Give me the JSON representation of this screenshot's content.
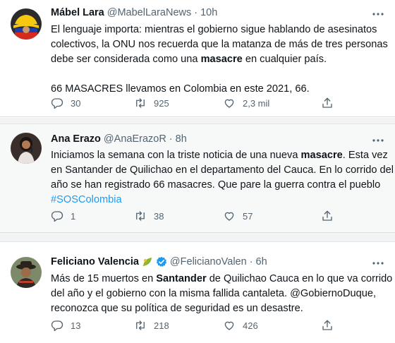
{
  "tweets": [
    {
      "name": "Mábel Lara",
      "handle": "@MabelLaraNews",
      "dot": "·",
      "time": "10h",
      "avatar_icon": "colombian-flag-hat-avatar",
      "lines": [
        [
          {
            "text": "El lenguaje importa: mientras el gobierno sigue hablando de asesinatos"
          }
        ],
        [
          {
            "text": "colectivos, la ONU nos recuerda que la matanza de más de tres personas"
          }
        ],
        [
          {
            "text": "debe ser considerada como una "
          },
          {
            "text": "masacre",
            "bold": true
          },
          {
            "text": " en cualquier país."
          }
        ],
        [
          {
            "text": "66 MASACRES llevamos en Colombia en este 2021, 66."
          }
        ]
      ],
      "replies": "30",
      "retweets": "925",
      "likes": "2,3 mil"
    },
    {
      "name": "Ana Erazo",
      "handle": "@AnaErazoR",
      "dot": "·",
      "time": "8h",
      "avatar_icon": "woman-with-microphone-avatar",
      "lines": [
        [
          {
            "text": "Iniciamos la semana con la triste noticia de una nueva "
          },
          {
            "text": "masacre",
            "bold": true
          },
          {
            "text": ". Esta vez"
          }
        ],
        [
          {
            "text": "en Santander de Quilichao en el departamento del Cauca. En lo corrido del"
          }
        ],
        [
          {
            "text": "año se han registrado 66 masacres. Que pare la guerra contra el pueblo"
          }
        ],
        [
          {
            "text": "#SOSColombia",
            "link": true
          }
        ]
      ],
      "replies": "1",
      "retweets": "38",
      "likes": "57"
    },
    {
      "name": "Feliciano Valencia",
      "handle": "@FelicianoValen",
      "dot": "·",
      "time": "6h",
      "avatar_icon": "man-with-hat-avatar",
      "lines": [
        [
          {
            "text": "Más de 15 muertos en "
          },
          {
            "text": "Santander",
            "bold": true
          },
          {
            "text": " de Quilichao Cauca en lo que va corrido"
          }
        ],
        [
          {
            "text": "del año y el gobierno con la misma fallida cantaleta. @GobiernoDuque,"
          }
        ],
        [
          {
            "text": "reconozca que su política de seguridad es un desastre."
          }
        ]
      ],
      "replies": "13",
      "retweets": "218",
      "likes": "426"
    }
  ],
  "colors": {
    "text": "#0f1419",
    "secondary": "#536471",
    "link": "#1d9bf0",
    "verified": "#1d9bf0",
    "highlight_bg": "#f7f9f9"
  }
}
